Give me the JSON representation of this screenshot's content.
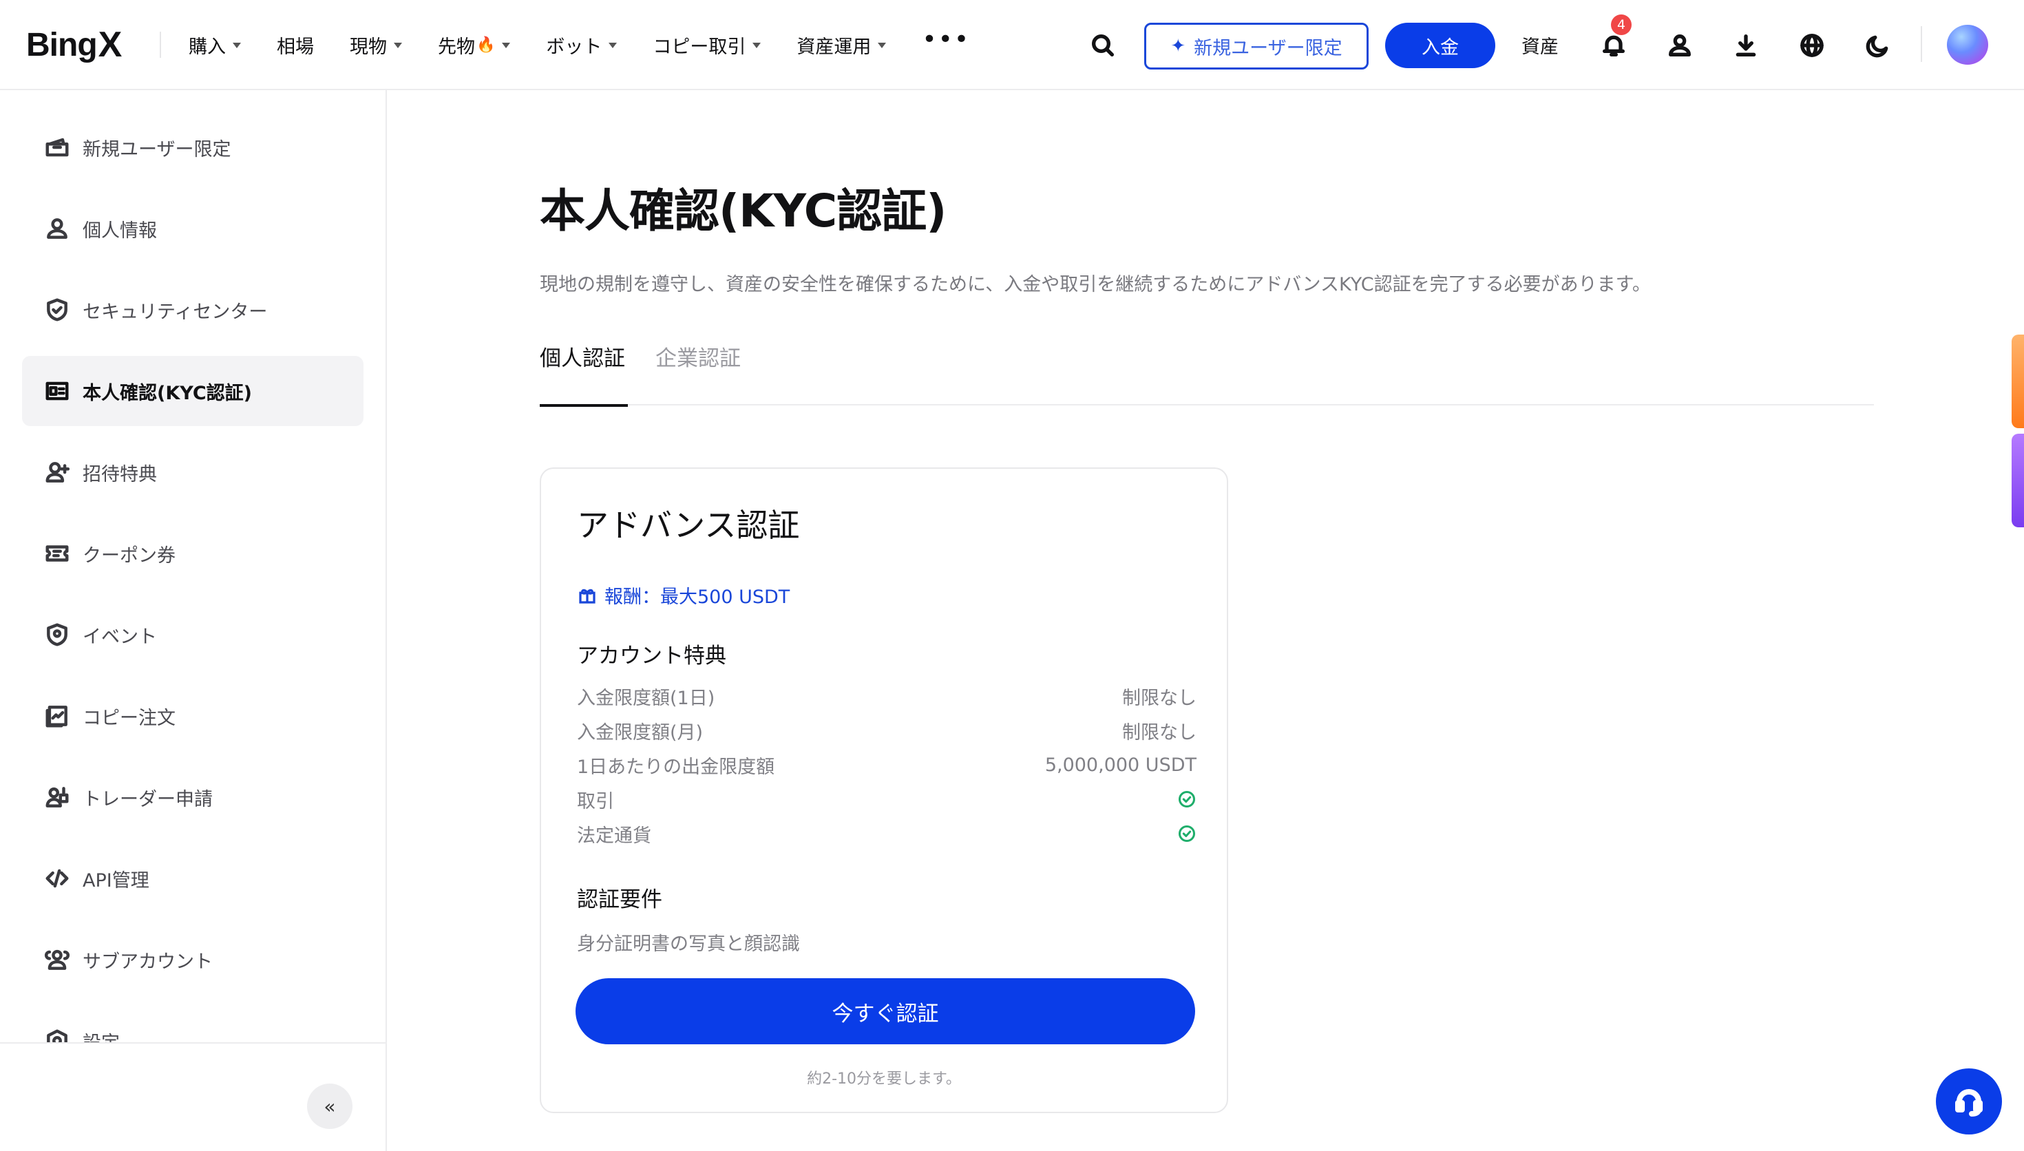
{
  "brand": {
    "name": "Bing",
    "name_x": "X",
    "accent": "#0a3de8"
  },
  "nav": {
    "menu": [
      {
        "label": "購入",
        "caret": true
      },
      {
        "label": "相場",
        "caret": false
      },
      {
        "label": "現物",
        "caret": true
      },
      {
        "label": "先物",
        "caret": true
      },
      {
        "label": "ボット",
        "caret": true
      },
      {
        "label": "コピー取引",
        "caret": true
      },
      {
        "label": "資産運用",
        "caret": true
      }
    ],
    "more_label": "•••",
    "promo_label": "新規ユーザー限定",
    "deposit_label": "入金",
    "assets_label": "資産",
    "notification_count": "4"
  },
  "sidebar": {
    "items": [
      {
        "label": "新規ユーザー限定",
        "icon": "gift-ticket-icon"
      },
      {
        "label": "個人情報",
        "icon": "user-icon"
      },
      {
        "label": "セキュリティセンター",
        "icon": "shield-check-icon"
      },
      {
        "label": "本人確認(KYC認証)",
        "icon": "id-card-icon",
        "active": true
      },
      {
        "label": "招待特典",
        "icon": "user-plus-icon"
      },
      {
        "label": "クーポン券",
        "icon": "coupon-icon"
      },
      {
        "label": "イベント",
        "icon": "event-shield-icon"
      },
      {
        "label": "コピー注文",
        "icon": "copy-order-icon"
      },
      {
        "label": "トレーダー申請",
        "icon": "trader-icon"
      },
      {
        "label": "API管理",
        "icon": "code-icon"
      },
      {
        "label": "サブアカウント",
        "icon": "sub-account-icon"
      },
      {
        "label": "設定",
        "icon": "settings-icon"
      }
    ],
    "collapse_label": "«"
  },
  "main": {
    "title": "本人確認(KYC認証)",
    "description": "現地の規制を遵守し、資産の安全性を確保するために、入金や取引を継続するためにアドバンスKYC認証を完了する必要があります。",
    "tabs": [
      {
        "label": "個人認証",
        "active": true
      },
      {
        "label": "企業認証",
        "active": false
      }
    ],
    "card": {
      "title": "アドバンス認証",
      "reward": "報酬：最大500 USDT",
      "benefits_title": "アカウント特典",
      "benefits": [
        {
          "label": "入金限度額(1日)",
          "value": "制限なし"
        },
        {
          "label": "入金限度額(月)",
          "value": "制限なし"
        },
        {
          "label": "1日あたりの出金限度額",
          "value": "5,000,000 USDT"
        },
        {
          "label": "取引",
          "value": ""
        },
        {
          "label": "法定通貨",
          "value": ""
        }
      ],
      "requirements_title": "認証要件",
      "requirements_text": "身分証明書の写真と顔認識",
      "button_label": "今すぐ認証",
      "time_note": "約2-10分を要します。"
    }
  }
}
